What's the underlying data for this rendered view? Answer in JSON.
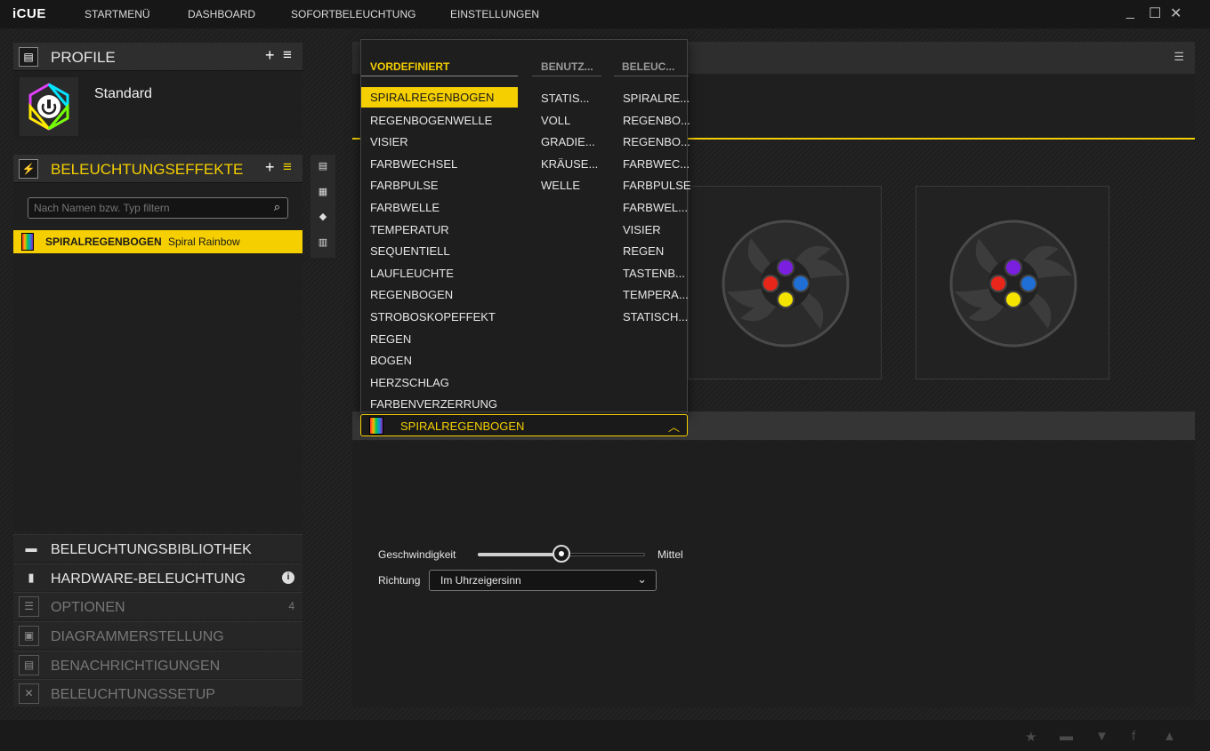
{
  "app": {
    "logo": "iCUE"
  },
  "nav": [
    "STARTMENÜ",
    "DASHBOARD",
    "SOFORTBELEUCHTUNG",
    "EINSTELLUNGEN"
  ],
  "window": {
    "minimize": "_",
    "maximize": "☐",
    "close": "✕"
  },
  "profile": {
    "title": "PROFILE",
    "plus": "+",
    "menu": "≡",
    "name": "Standard"
  },
  "effects": {
    "title": "BELEUCHTUNGSEFFEKTE",
    "plus": "+",
    "menu": "≡",
    "filter_placeholder": "Nach Namen bzw. Typ filtern",
    "item_name": "SPIRALREGENBOGEN",
    "item_sub": "Spiral Rainbow"
  },
  "sidebar": {
    "items": [
      {
        "label": "BELEUCHTUNGSBIBLIOTHEK",
        "icon": "folder-icon"
      },
      {
        "label": "HARDWARE-BELEUCHTUNG",
        "icon": "device-icon",
        "info": "i"
      },
      {
        "label": "OPTIONEN",
        "icon": "options-icon",
        "badge": "4"
      },
      {
        "label": "DIAGRAMMERSTELLUNG",
        "icon": "graph-icon"
      },
      {
        "label": "BENACHRICHTIGUNGEN",
        "icon": "notification-icon"
      },
      {
        "label": "BELEUCHTUNGSSETUP",
        "icon": "tools-icon"
      }
    ]
  },
  "dropdown": {
    "columns": [
      {
        "header": "VORDEFINIERT",
        "items": [
          "SPIRALREGENBOGEN",
          "REGENBOGENWELLE",
          "VISIER",
          "FARBWECHSEL",
          "FARBPULSE",
          "FARBWELLE",
          "TEMPERATUR",
          "SEQUENTIELL",
          "LAUFLEUCHTE",
          "REGENBOGEN",
          "STROBOSKOPEFFEKT",
          "REGEN",
          "BOGEN",
          "HERZSCHLAG",
          "FARBENVERZERRUNG"
        ]
      },
      {
        "header": "BENUTZ...",
        "items": [
          "STATIS...",
          "VOLL",
          "GRADIE...",
          "KRÄUSE...",
          "WELLE"
        ]
      },
      {
        "header": "BELEUC...",
        "items": [
          "SPIRALRE...",
          "REGENBO...",
          "REGENBO...",
          "FARBWEC...",
          "FARBPULSE",
          "FARBWEL...",
          "VISIER",
          "REGEN",
          "TASTENB...",
          "TEMPERA...",
          "STATISCH..."
        ]
      }
    ],
    "selected": "SPIRALREGENBOGEN",
    "chevron": "^"
  },
  "settings": {
    "speed_label": "Geschwindigkeit",
    "speed_value": "Mittel",
    "speed_level": 0.5,
    "direction_label": "Richtung",
    "direction_value": "Im Uhrzeigersinn"
  },
  "colors": {
    "accent": "#f5cf00",
    "panel": "#2e2e2e",
    "background": "#1c1c1c"
  },
  "footer_icons": [
    "rating-icon",
    "chat-icon",
    "twitter-icon",
    "facebook-icon",
    "corsair-icon"
  ]
}
